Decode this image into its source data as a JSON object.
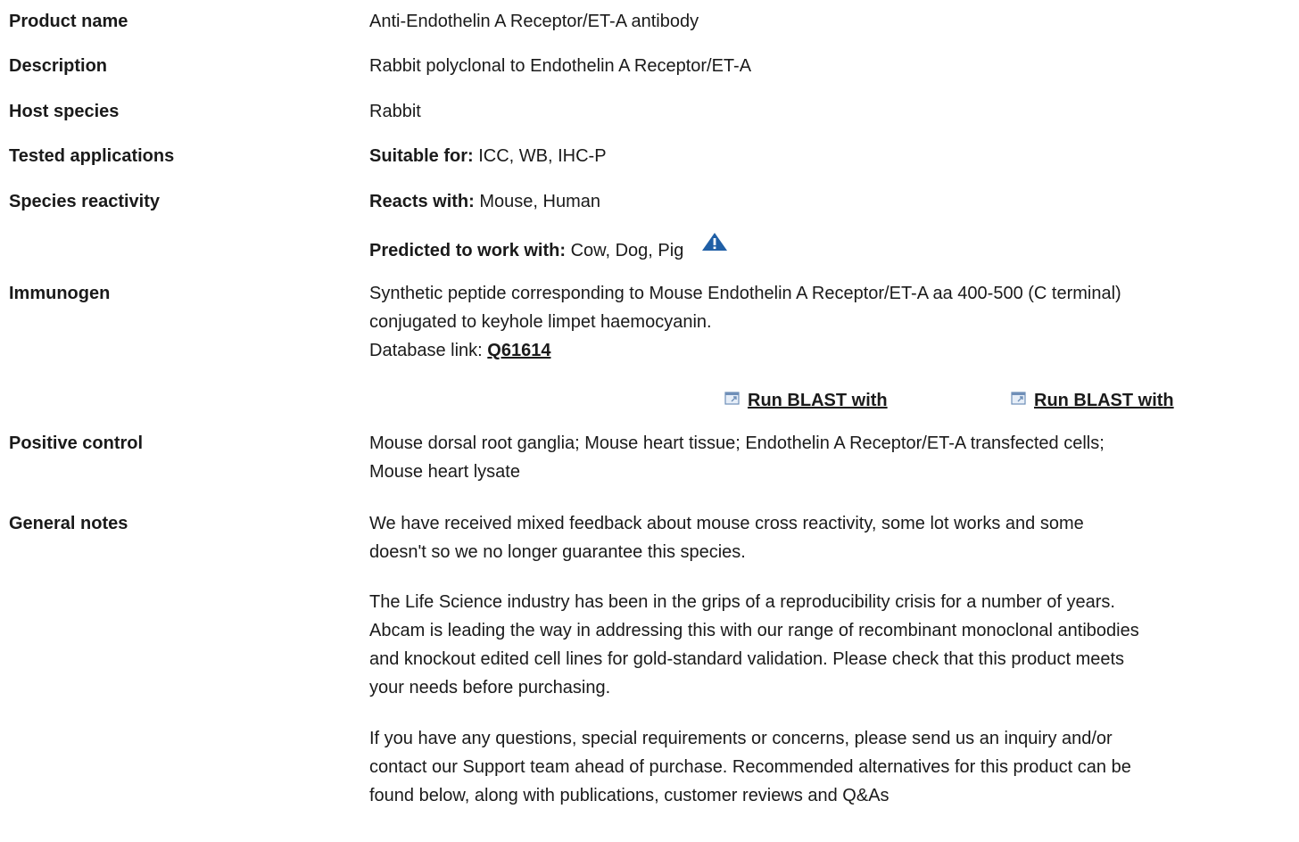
{
  "rows": {
    "product_name": {
      "label": "Product name",
      "value": "Anti-Endothelin A Receptor/ET-A antibody"
    },
    "description": {
      "label": "Description",
      "value": "Rabbit polyclonal to Endothelin A Receptor/ET-A"
    },
    "host_species": {
      "label": "Host species",
      "value": "Rabbit"
    },
    "tested_applications": {
      "label": "Tested applications",
      "prefix": "Suitable for:",
      "value": " ICC, WB, IHC-P"
    },
    "species_reactivity": {
      "label": "Species reactivity",
      "reacts_prefix": "Reacts with:",
      "reacts_value": " Mouse, Human",
      "predicted_prefix": "Predicted to work with:",
      "predicted_value": " Cow, Dog, Pig"
    },
    "immunogen": {
      "label": "Immunogen",
      "line1": "Synthetic peptide corresponding to Mouse Endothelin A Receptor/ET-A aa 400-500 (C terminal)",
      "line2": "conjugated to keyhole limpet haemocyanin.",
      "db_prefix": "Database link: ",
      "db_link": "Q61614",
      "blast_1": "Run BLAST with",
      "blast_2": "Run BLAST with"
    },
    "positive_control": {
      "label": "Positive control",
      "line1": "Mouse dorsal root ganglia; Mouse heart tissue; Endothelin A Receptor/ET-A transfected cells;",
      "line2": "Mouse heart lysate"
    },
    "general_notes": {
      "label": "General notes",
      "p1_l1": "We have received mixed feedback about mouse cross reactivity, some lot works and some",
      "p1_l2": "doesn't so we no longer guarantee this species.",
      "p2_l1": "The Life Science industry has been in the grips of a reproducibility crisis for a number of years.",
      "p2_l2": "Abcam is leading the way in addressing this with our range of recombinant monoclonal antibodies",
      "p2_l3": "and knockout edited cell lines for gold-standard validation. Please check that this product meets",
      "p2_l4": "your needs before purchasing.",
      "p3_l1": "If you have any questions, special requirements or concerns, please send us an inquiry and/or",
      "p3_l2": "contact our Support team ahead of purchase. Recommended alternatives for this product can be",
      "p3_l3": "found below, along with publications, customer reviews and Q&As"
    }
  },
  "colors": {
    "text": "#1a1a1a",
    "warn_icon": "#1f5fa6",
    "ext_icon": "#6f8fb8"
  }
}
